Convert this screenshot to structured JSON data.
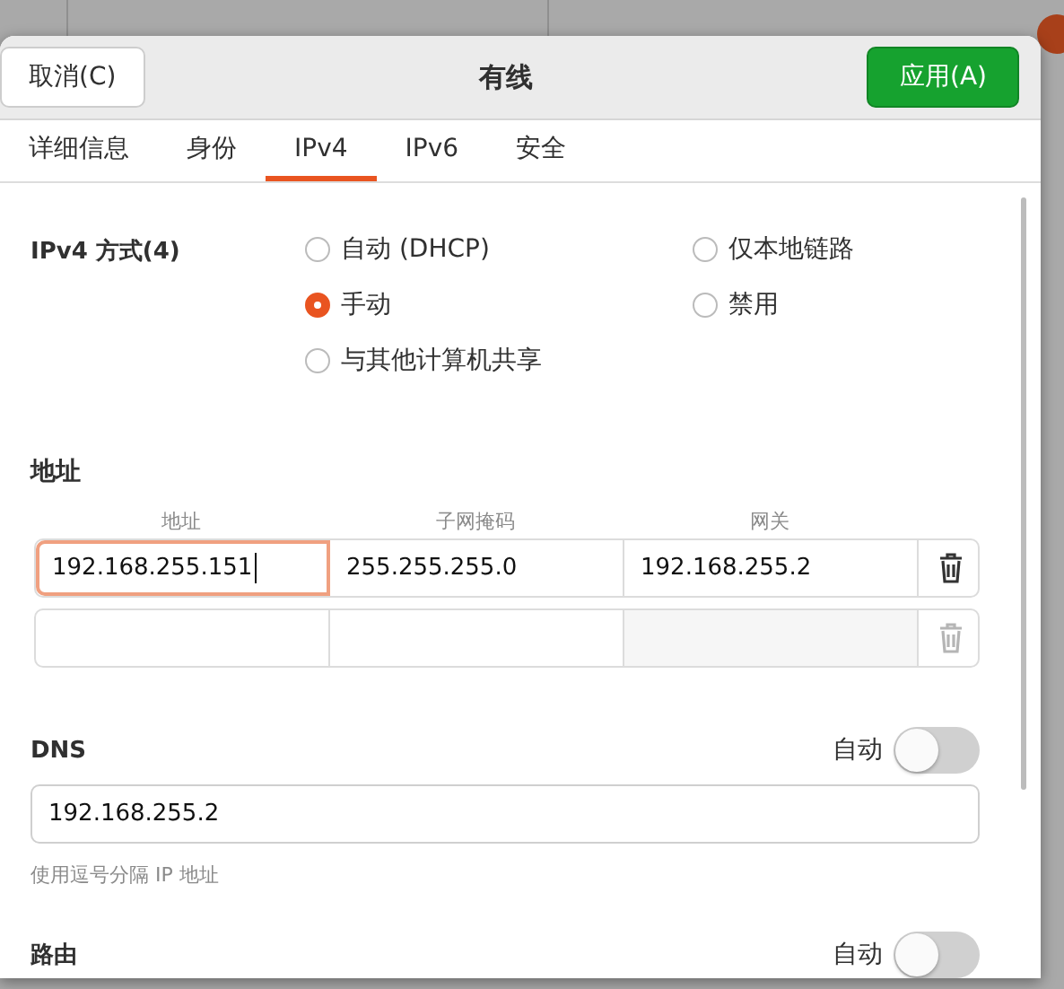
{
  "dialog": {
    "title": "有线",
    "cancel_button": "取消(C)",
    "apply_button": "应用(A)",
    "tabs": [
      {
        "label": "详细信息",
        "selected": false
      },
      {
        "label": "身份",
        "selected": false
      },
      {
        "label": "IPv4",
        "selected": true
      },
      {
        "label": "IPv6",
        "selected": false
      },
      {
        "label": "安全",
        "selected": false
      }
    ],
    "ipv4_method": {
      "label": "IPv4 方式(4)",
      "options": [
        {
          "label": "自动 (DHCP)",
          "selected": false
        },
        {
          "label": "仅本地链路",
          "selected": false
        },
        {
          "label": "手动",
          "selected": true
        },
        {
          "label": "禁用",
          "selected": false
        },
        {
          "label": "与其他计算机共享",
          "selected": false
        }
      ]
    },
    "addresses": {
      "title": "地址",
      "columns": [
        "地址",
        "子网掩码",
        "网关"
      ],
      "rows": [
        {
          "address": "192.168.255.151",
          "netmask": "255.255.255.0",
          "gateway": "192.168.255.2",
          "focused": true,
          "disabled": false
        },
        {
          "address": "",
          "netmask": "",
          "gateway": "",
          "focused": false,
          "disabled": true
        }
      ]
    },
    "dns": {
      "title": "DNS",
      "auto_label": "自动",
      "auto_on": false,
      "value": "192.168.255.2",
      "hint": "使用逗号分隔 IP 地址"
    },
    "routes": {
      "title": "路由",
      "auto_label": "自动",
      "auto_on": false
    }
  }
}
